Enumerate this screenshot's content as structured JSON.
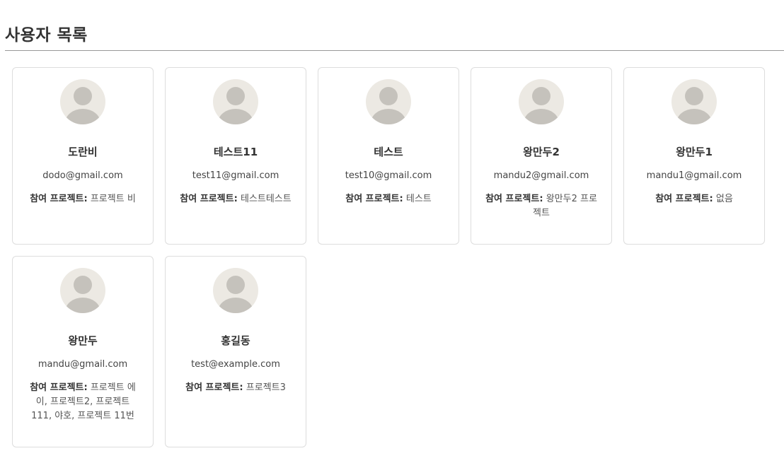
{
  "page": {
    "title": "사용자 목록",
    "project_label": "참여 프로젝트:"
  },
  "colors": {
    "avatar_bg": "#ece9e3",
    "avatar_fg": "#c5c2bc",
    "card_border": "#dddddd",
    "rule": "#999999"
  },
  "users": [
    {
      "name": "도란비",
      "email": "dodo@gmail.com",
      "projects": "프로젝트 비"
    },
    {
      "name": "테스트11",
      "email": "test11@gmail.com",
      "projects": "테스트테스트"
    },
    {
      "name": "테스트",
      "email": "test10@gmail.com",
      "projects": "테스트"
    },
    {
      "name": "왕만두2",
      "email": "mandu2@gmail.com",
      "projects": "왕만두2 프로젝트"
    },
    {
      "name": "왕만두1",
      "email": "mandu1@gmail.com",
      "projects": "없음"
    },
    {
      "name": "왕만두",
      "email": "mandu@gmail.com",
      "projects": "프로젝트 에이, 프로젝트2, 프로젝트111, 야호, 프로젝트 11번"
    },
    {
      "name": "홍길동",
      "email": "test@example.com",
      "projects": "프로젝트3"
    }
  ]
}
